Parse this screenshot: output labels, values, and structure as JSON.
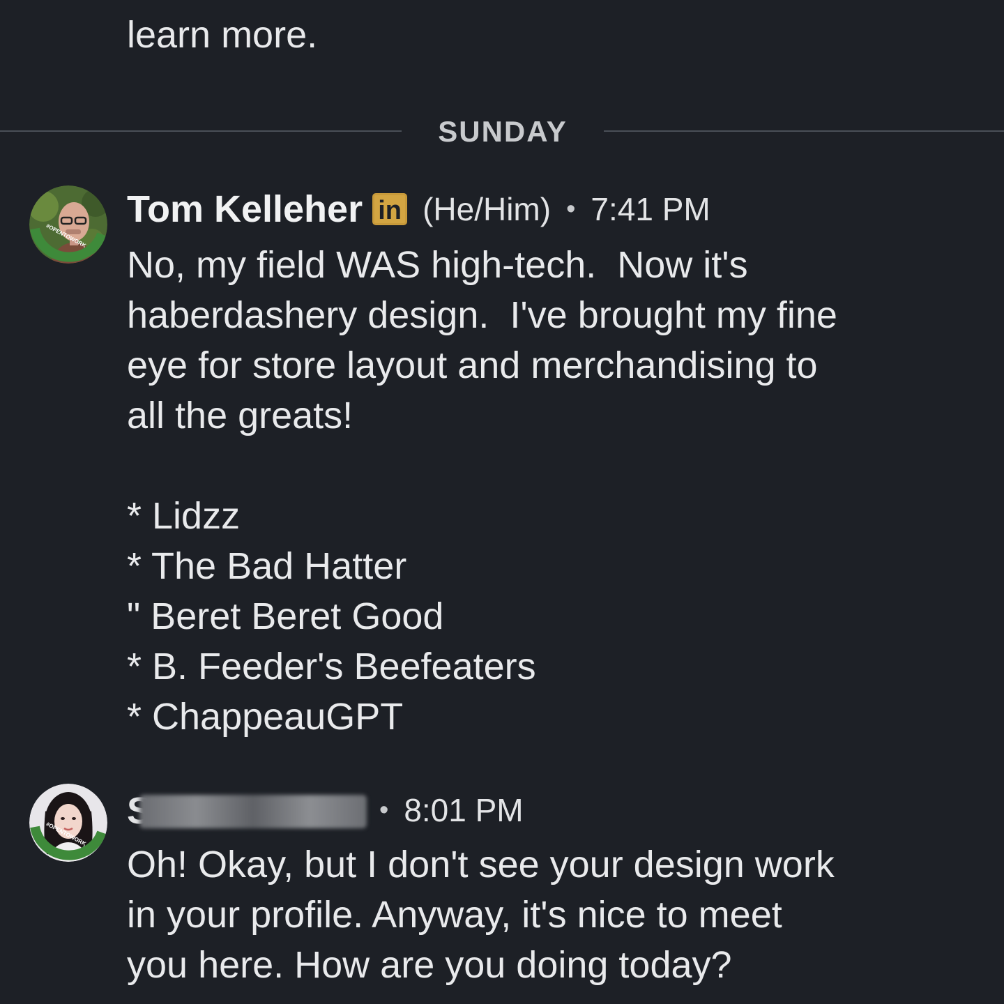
{
  "previous_message": {
    "text_tail": "learn more."
  },
  "day_divider": {
    "label": "SUNDAY"
  },
  "messages": [
    {
      "sender": "Tom Kelleher",
      "badge": "in",
      "pronouns": "(He/Him)",
      "separator": "•",
      "time": "7:41 PM",
      "avatar_icon": "profile-photo-opentowork",
      "avatar_frame_text": "#OPENTOWORK",
      "body": "No, my field WAS high-tech.  Now it's\nhaberdashery design.  I've brought my fine\neye for store layout and merchandising to\nall the greats!\n\n* Lidzz\n* The Bad Hatter\n\" Beret Beret Good\n* B. Feeder's Beefeaters\n* ChappeauGPT"
    },
    {
      "sender_visible": "S",
      "separator": "•",
      "time": "8:01 PM",
      "avatar_icon": "profile-photo-opentowork",
      "avatar_frame_text": "#OPENTOWORK",
      "body": "Oh! Okay, but I don't see your design work\nin your profile. Anyway, it's nice to meet\nyou here. How are you doing today?"
    }
  ],
  "colors": {
    "background": "#1d2026",
    "text": "#e9eaec",
    "divider": "#4a4f57",
    "opentowork_green": "#3e8a3a",
    "linkedin_badge": "#d3a542"
  }
}
